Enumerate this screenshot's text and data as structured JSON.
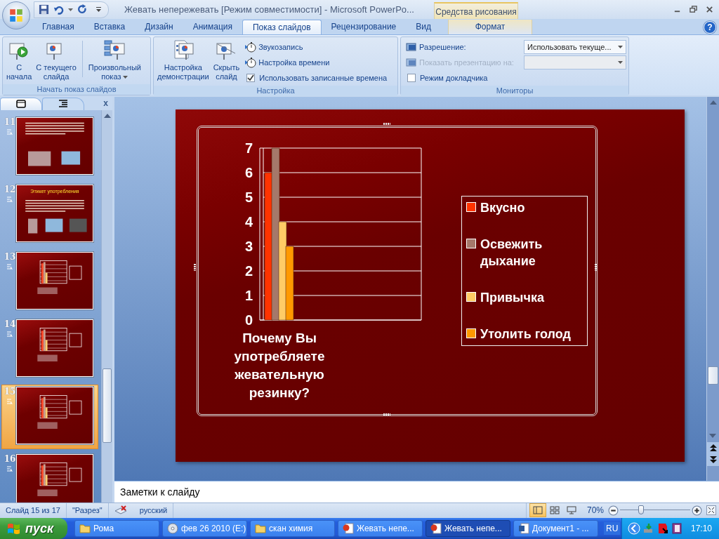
{
  "window": {
    "title": "Жевать непережевать [Режим совместимости] - Microsoft PowerPo...",
    "context_group": "Средства рисования",
    "help_label": "?"
  },
  "ribbon_tabs": [
    {
      "label": "Главная",
      "kind": "standard",
      "selected": false
    },
    {
      "label": "Вставка",
      "kind": "standard",
      "selected": false
    },
    {
      "label": "Дизайн",
      "kind": "standard",
      "selected": false
    },
    {
      "label": "Анимация",
      "kind": "standard",
      "selected": false
    },
    {
      "label": "Показ слайдов",
      "kind": "standard",
      "selected": true
    },
    {
      "label": "Рецензирование",
      "kind": "standard",
      "selected": false
    },
    {
      "label": "Вид",
      "kind": "standard",
      "selected": false
    },
    {
      "label": "Формат",
      "kind": "contextual",
      "selected": false
    }
  ],
  "ribbon_groups": [
    {
      "title": "Начать показ слайдов",
      "items": [
        {
          "kind": "large",
          "lines": [
            "С",
            "начала"
          ],
          "dropdown": false
        },
        {
          "kind": "large",
          "lines": [
            "С текущего",
            "слайда"
          ],
          "dropdown": false
        },
        {
          "kind": "large",
          "lines": [
            "Произвольный",
            "показ"
          ],
          "dropdown": true
        }
      ]
    },
    {
      "title": "Настройка",
      "items": [
        {
          "kind": "large",
          "lines": [
            "Настройка",
            "демонстрации"
          ],
          "dropdown": false
        },
        {
          "kind": "large",
          "lines": [
            "Скрыть",
            "слайд"
          ],
          "dropdown": false
        },
        {
          "kind": "small",
          "label": "Звукозапись"
        },
        {
          "kind": "small",
          "label": "Настройка времени"
        },
        {
          "kind": "checkbox",
          "label": "Использовать записанные времена",
          "checked": true
        }
      ]
    },
    {
      "title": "Мониторы",
      "items": [
        {
          "kind": "select",
          "label": "Разрешение:",
          "value": "Использовать текуще...",
          "disabled": false
        },
        {
          "kind": "select",
          "label": "Показать презентацию на:",
          "disabled": true
        },
        {
          "kind": "checkbox",
          "label": "Режим докладчика",
          "checked": false
        }
      ]
    }
  ],
  "slide_panel": {
    "tabs": [
      {
        "selected": true
      },
      {
        "selected": false
      }
    ],
    "close_label": "x",
    "slides": [
      {
        "number": "11",
        "kind": "text_photos",
        "selected": false
      },
      {
        "number": "12",
        "kind": "text_photos",
        "title": "Этикет употребления",
        "selected": false
      },
      {
        "number": "13",
        "kind": "chart",
        "selected": false
      },
      {
        "number": "14",
        "kind": "chart",
        "selected": false
      },
      {
        "number": "15",
        "kind": "chart",
        "selected": true
      },
      {
        "number": "16",
        "kind": "chart",
        "selected": false
      }
    ]
  },
  "slide": {
    "chart_data": {
      "type": "bar",
      "grid": true,
      "categories": [
        "Почему Вы употребляете жевательную резинку?"
      ],
      "ylim": [
        0,
        7
      ],
      "yticks": [
        0,
        1,
        2,
        3,
        4,
        5,
        6,
        7
      ],
      "series": [
        {
          "name": "Вкусно",
          "color": "#ff3300",
          "values": [
            6
          ]
        },
        {
          "name": "Освежить дыхание",
          "color": "#a5786a",
          "values": [
            7
          ]
        },
        {
          "name": "Привычка",
          "color": "#ffcc66",
          "values": [
            4
          ]
        },
        {
          "name": "Утолить голод",
          "color": "#ff9900",
          "values": [
            3
          ]
        }
      ]
    }
  },
  "notes": {
    "text": "Заметки к слайду"
  },
  "status_bar": {
    "slide_info": "Слайд 15 из 17",
    "theme": "\"Разрез\"",
    "language": "русский",
    "views": [
      {
        "selected": true
      },
      {
        "selected": false
      },
      {
        "selected": false
      }
    ],
    "zoom": "70%",
    "zoom_slider": {
      "level": 0.3
    }
  },
  "taskbar": {
    "start": "пуск",
    "tasks": [
      {
        "label": "Рома",
        "kind": "folder",
        "selected": false
      },
      {
        "label": "фев 26 2010 (E:)",
        "kind": "disc",
        "selected": false
      },
      {
        "label": "скан химия",
        "kind": "folder",
        "selected": false
      },
      {
        "label": "Жевать непе...",
        "kind": "presentation",
        "selected": false
      },
      {
        "label": "Жевать непе...",
        "kind": "presentation",
        "selected": true
      },
      {
        "label": "Документ1 - ...",
        "kind": "document",
        "selected": false
      }
    ],
    "language": "RU",
    "clock": "17:10"
  }
}
